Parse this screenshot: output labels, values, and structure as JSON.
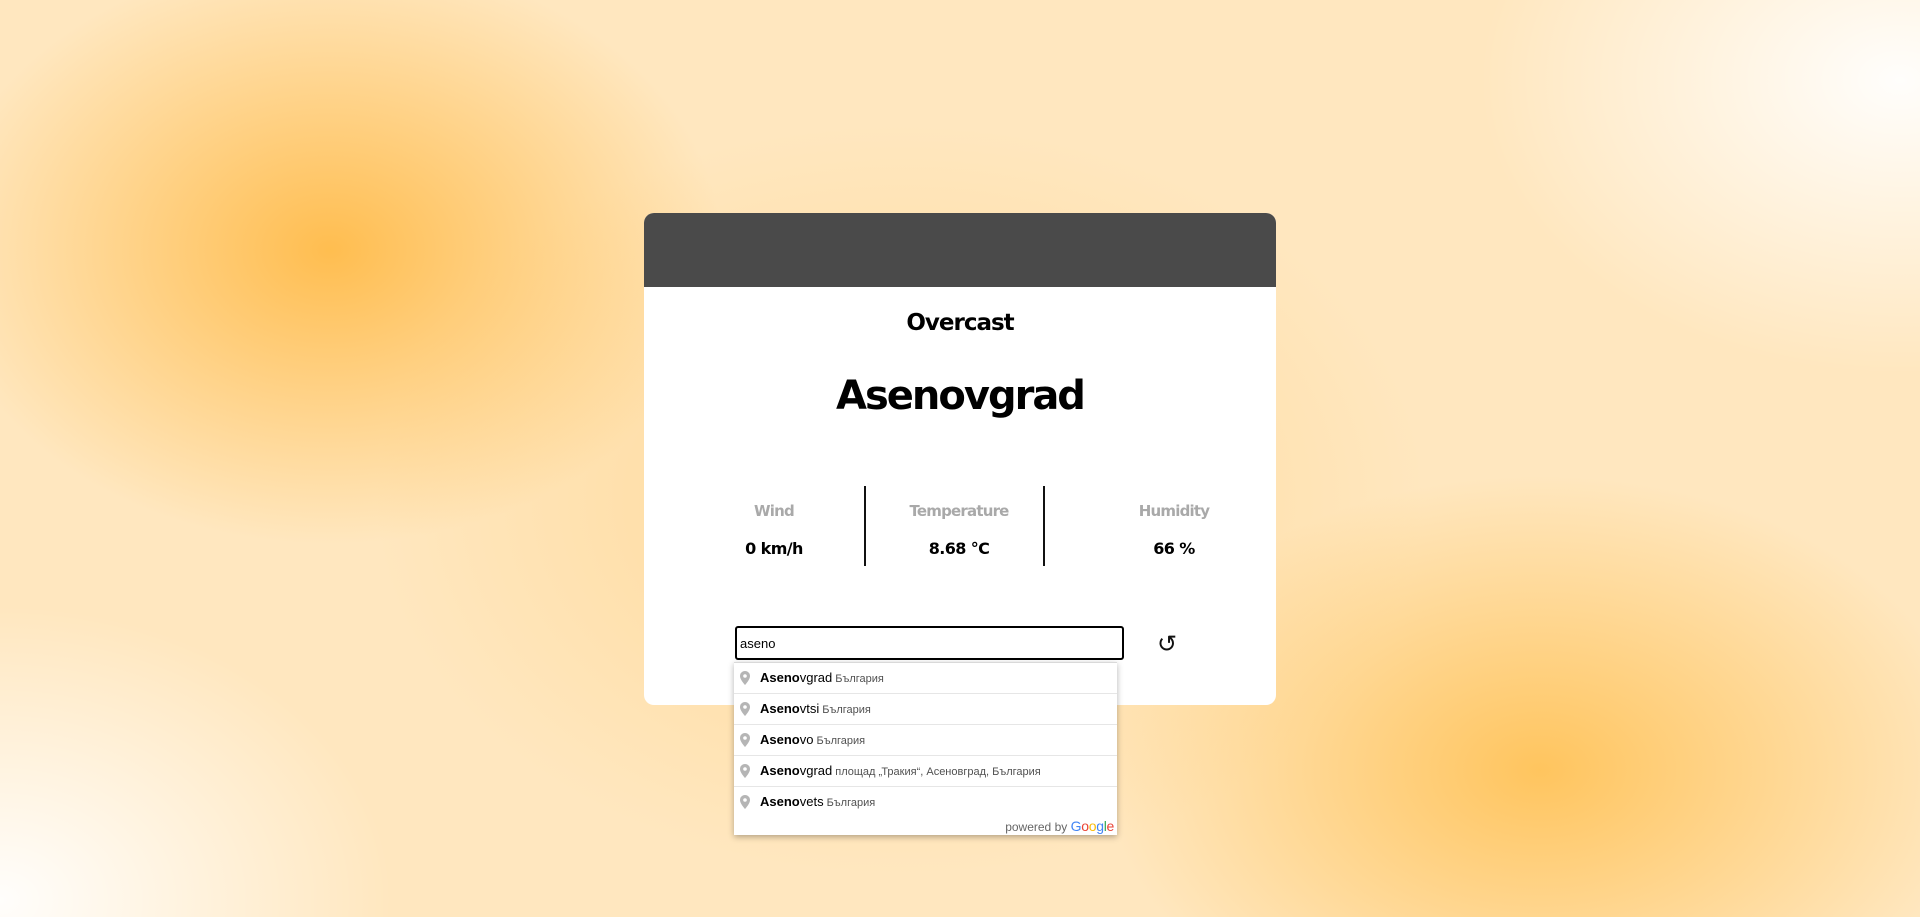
{
  "weather": {
    "condition": "Overcast",
    "city": "Asenovgrad",
    "stats": [
      {
        "label": "Wind",
        "value": "0 km/h"
      },
      {
        "label": "Temperature",
        "value": "8.68 °C"
      },
      {
        "label": "Humidity",
        "value": "66 %"
      }
    ]
  },
  "search": {
    "value": "aseno",
    "reload_icon": "↺"
  },
  "autocomplete": {
    "items": [
      {
        "match": "Aseno",
        "rest": "vgrad",
        "secondary": "България"
      },
      {
        "match": "Aseno",
        "rest": "vtsi",
        "secondary": "България"
      },
      {
        "match": "Aseno",
        "rest": "vo",
        "secondary": "България"
      },
      {
        "match": "Aseno",
        "rest": "vgrad",
        "secondary": "площад „Тракия“, Асеновград, България"
      },
      {
        "match": "Aseno",
        "rest": "vets",
        "secondary": "България"
      }
    ],
    "footer": {
      "powered_by": "powered by",
      "logo_letters": [
        "G",
        "o",
        "o",
        "g",
        "l",
        "e"
      ],
      "logo_colors": [
        "#4285F4",
        "#EA4335",
        "#FBBC05",
        "#4285F4",
        "#34A853",
        "#EA4335"
      ]
    },
    "icon": "map-pin-icon"
  },
  "colors": {
    "card_header": "#4a4a4a",
    "stat_label": "#a9a9a9"
  }
}
